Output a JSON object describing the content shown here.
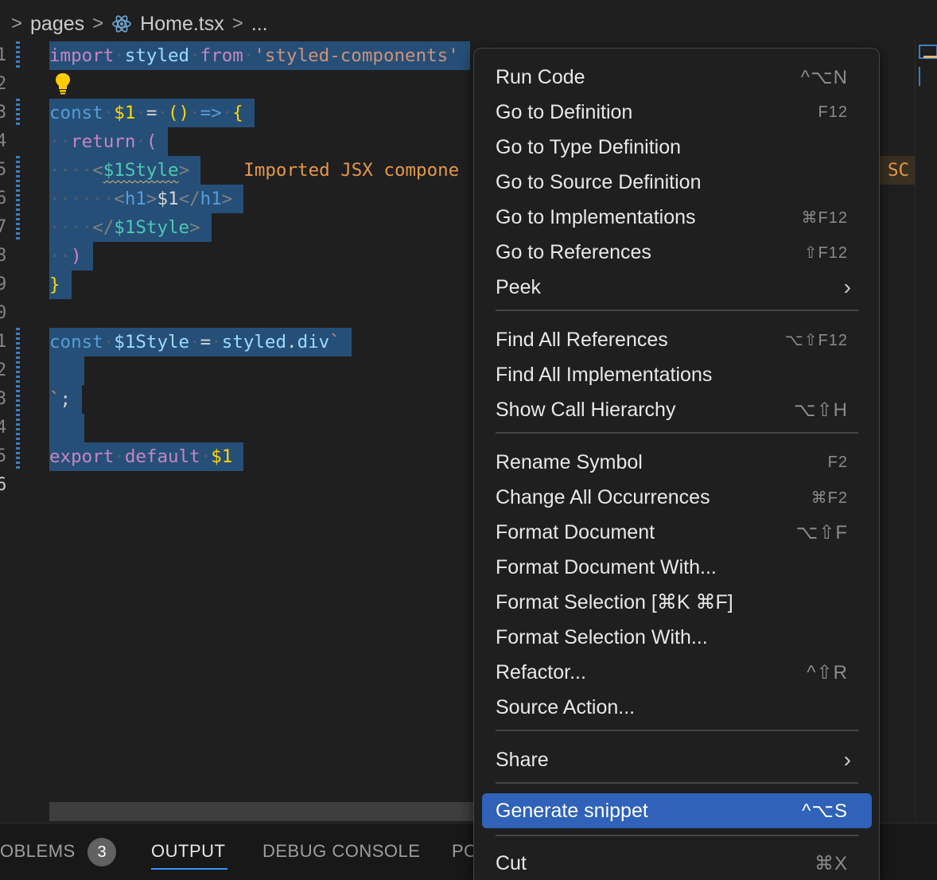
{
  "breadcrumb": {
    "folder": "pages",
    "file": "Home.tsx",
    "more": "..."
  },
  "editor": {
    "line_numbers": [
      "1",
      "2",
      "3",
      "4",
      "5",
      "6",
      "7",
      "8",
      "9",
      "0",
      "1",
      "2",
      "3",
      "4",
      "5",
      "6"
    ],
    "inline_hint": "Imported JSX compone",
    "inline_hint_tail": "SC"
  },
  "code": {
    "l1": {
      "kw1": "import",
      "id": "styled",
      "kw2": "from",
      "str": "'styled-components'"
    },
    "l3": {
      "kw": "const",
      "name": "$1",
      "eq": "=",
      "parens": "()",
      "arrow": "=>",
      "brace": "{"
    },
    "l4": {
      "kw": "return",
      "paren": "("
    },
    "l5": {
      "open": "<",
      "comp": "$1Style",
      "close": ">"
    },
    "l6": {
      "open": "<",
      "tag": "h1",
      "close": ">",
      "text": "$1",
      "eopen": "</",
      "etag": "h1",
      "eclose": ">"
    },
    "l7": {
      "open": "</",
      "comp": "$1Style",
      "close": ">"
    },
    "l8": {
      "paren": ")"
    },
    "l9": {
      "brace": "}"
    },
    "l11": {
      "kw": "const",
      "name": "$1Style",
      "eq": "=",
      "obj": "styled",
      "dot": ".",
      "prop": "div",
      "tick": "`"
    },
    "l13": {
      "tick": "`",
      "semi": ";"
    },
    "l15": {
      "kw1": "export",
      "kw2": "default",
      "name": "$1"
    }
  },
  "panel": {
    "tabs": [
      "OBLEMS",
      "OUTPUT",
      "DEBUG CONSOLE",
      "PO"
    ],
    "problems_count": "3",
    "active_tab": "OUTPUT"
  },
  "context_menu": {
    "items": [
      {
        "label": "Run Code",
        "shortcut": "^⌥N"
      },
      {
        "label": "Go to Definition",
        "shortcut": "F12"
      },
      {
        "label": "Go to Type Definition",
        "shortcut": ""
      },
      {
        "label": "Go to Source Definition",
        "shortcut": ""
      },
      {
        "label": "Go to Implementations",
        "shortcut": "⌘F12"
      },
      {
        "label": "Go to References",
        "shortcut": "⇧F12"
      },
      {
        "label": "Peek",
        "shortcut": "›"
      },
      {
        "label": "Find All References",
        "shortcut": "⌥⇧F12"
      },
      {
        "label": "Find All Implementations",
        "shortcut": ""
      },
      {
        "label": "Show Call Hierarchy",
        "shortcut": "⌥⇧H"
      },
      {
        "label": "Rename Symbol",
        "shortcut": "F2"
      },
      {
        "label": "Change All Occurrences",
        "shortcut": "⌘F2"
      },
      {
        "label": "Format Document",
        "shortcut": "⌥⇧F"
      },
      {
        "label": "Format Document With...",
        "shortcut": ""
      },
      {
        "label": "Format Selection [⌘K ⌘F]",
        "shortcut": ""
      },
      {
        "label": "Format Selection With...",
        "shortcut": ""
      },
      {
        "label": "Refactor...",
        "shortcut": "^⇧R"
      },
      {
        "label": "Source Action...",
        "shortcut": ""
      },
      {
        "label": "Share",
        "shortcut": "›"
      },
      {
        "label": "Generate snippet",
        "shortcut": "^⌥S"
      },
      {
        "label": "Cut",
        "shortcut": "⌘X"
      }
    ]
  },
  "colors": {
    "menu_highlight": "#2f62b8",
    "selection": "#264f78",
    "background": "#1f1f1f"
  }
}
